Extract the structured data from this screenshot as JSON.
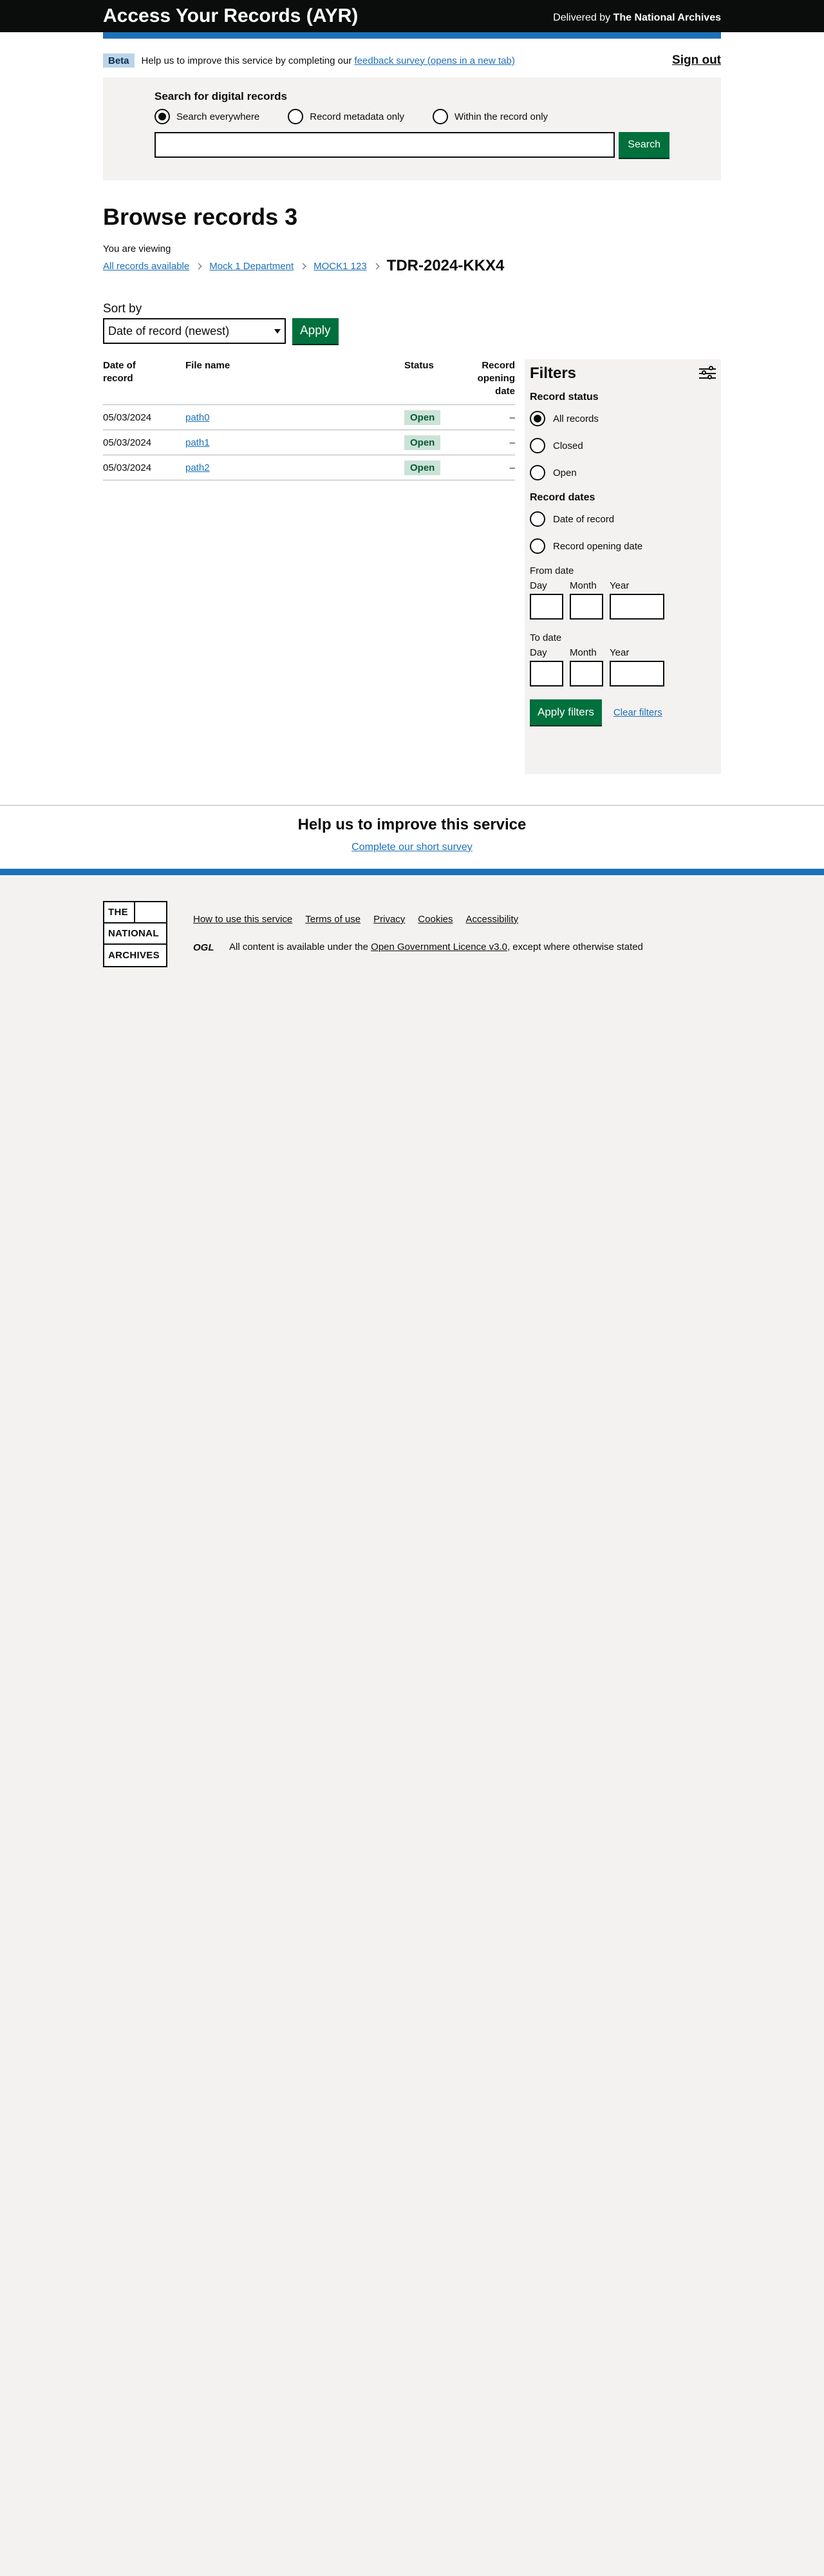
{
  "header": {
    "title": "Access Your Records (AYR)",
    "delivered_prefix": "Delivered by",
    "delivered_org": "The National Archives"
  },
  "phase": {
    "tag": "Beta",
    "text": "Help us to improve this service by completing our",
    "link": "feedback survey (opens in a new tab)",
    "sign_out": "Sign out"
  },
  "search": {
    "heading": "Search for digital records",
    "options": [
      "Search everywhere",
      "Record metadata only",
      "Within the record only"
    ],
    "selected": 0,
    "input_value": "",
    "button": "Search"
  },
  "main": {
    "title": "Browse records 3",
    "you_are_viewing": "You are viewing",
    "breadcrumbs": [
      "All records available",
      "Mock 1 Department",
      "MOCK1 123"
    ],
    "current": "TDR-2024-KKX4",
    "sort_label": "Sort by",
    "sort_value": "Date of record (newest)",
    "apply": "Apply"
  },
  "table": {
    "headers": [
      "Date of record",
      "File name",
      "Status",
      "Record opening date"
    ],
    "rows": [
      {
        "date": "05/03/2024",
        "file": "path0",
        "status": "Open",
        "opening": "–"
      },
      {
        "date": "05/03/2024",
        "file": "path1",
        "status": "Open",
        "opening": "–"
      },
      {
        "date": "05/03/2024",
        "file": "path2",
        "status": "Open",
        "opening": "–"
      }
    ]
  },
  "filters": {
    "title": "Filters",
    "status_heading": "Record status",
    "status_options": [
      "All records",
      "Closed",
      "Open"
    ],
    "status_selected": 0,
    "dates_heading": "Record dates",
    "dates_options": [
      "Date of record",
      "Record opening date"
    ],
    "from_label": "From date",
    "to_label": "To date",
    "day": "Day",
    "month": "Month",
    "year": "Year",
    "apply": "Apply filters",
    "clear": "Clear filters"
  },
  "feedback": {
    "title": "Help us to improve this service",
    "link": "Complete our short survey"
  },
  "footer": {
    "logo_lines": [
      "THE",
      "NATIONAL",
      "ARCHIVES"
    ],
    "links": [
      "How to use this service",
      "Terms of use",
      "Privacy",
      "Cookies",
      "Accessibility"
    ],
    "licence_prefix": "All content is available under the",
    "licence_link": "Open Government Licence v3.0",
    "licence_suffix": ", except where otherwise stated",
    "ogl_text": "OGL"
  },
  "colors": {
    "header_bg": "#0b0c0c",
    "brand_blue": "#1d70b8",
    "button_green": "#00703c",
    "tag_green_bg": "#cce2d8",
    "beta_tag_bg": "#bbd4ea",
    "panel_grey": "#f3f2f1"
  }
}
